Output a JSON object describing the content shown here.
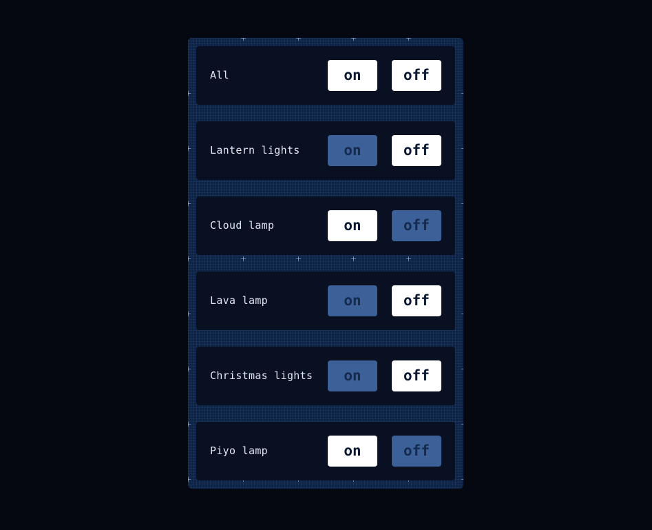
{
  "button_labels": {
    "on": "on",
    "off": "off"
  },
  "colors": {
    "page_background": "#050810",
    "panel_background": "#0c2345",
    "row_background": "#081022",
    "button_active": "#ffffff",
    "button_inactive": "#3c6199",
    "label_text": "#dfe7f5"
  },
  "rows": [
    {
      "label": "All",
      "on_state": "active",
      "off_state": "active"
    },
    {
      "label": "Lantern lights",
      "on_state": "inactive",
      "off_state": "active"
    },
    {
      "label": "Cloud lamp",
      "on_state": "active",
      "off_state": "inactive"
    },
    {
      "label": "Lava lamp",
      "on_state": "inactive",
      "off_state": "active"
    },
    {
      "label": "Christmas lights",
      "on_state": "inactive",
      "off_state": "active"
    },
    {
      "label": "Piyo lamp",
      "on_state": "active",
      "off_state": "inactive"
    }
  ]
}
